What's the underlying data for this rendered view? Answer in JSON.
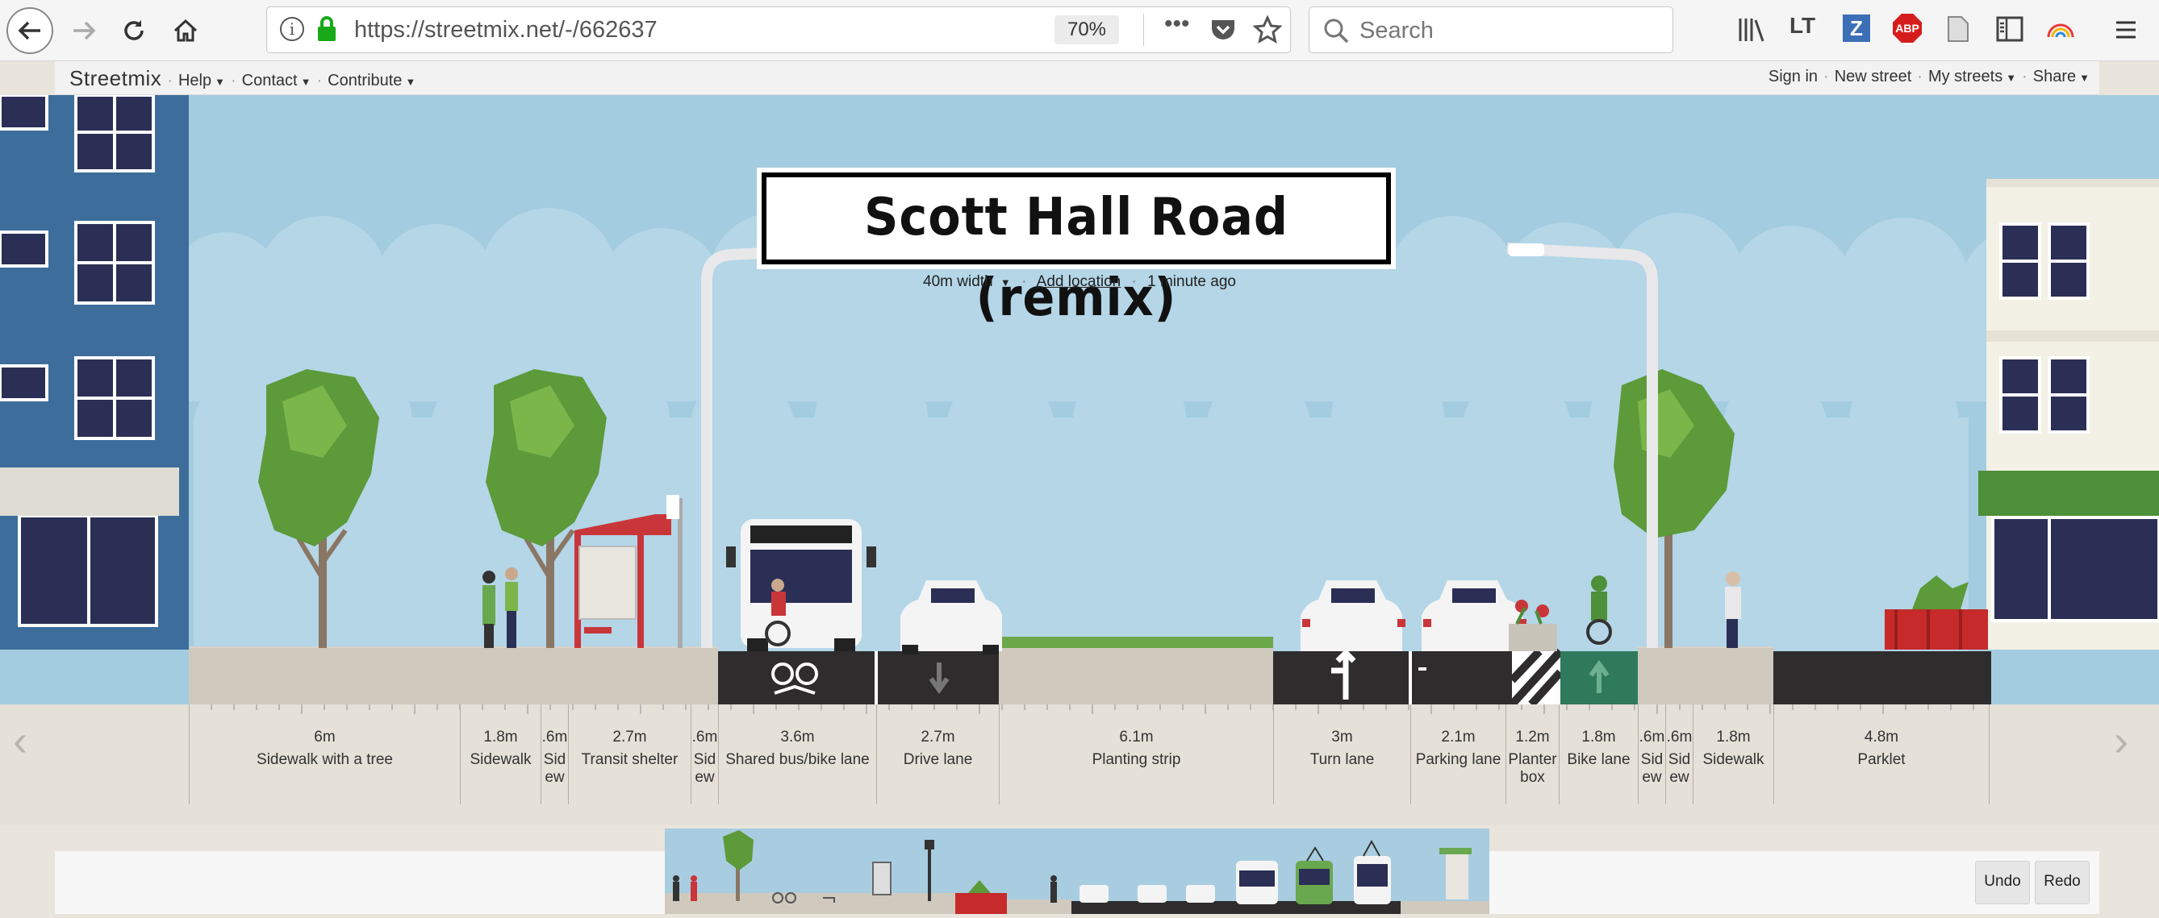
{
  "browser": {
    "url": "https://streetmix.net/-/662637",
    "zoom": "70%",
    "search_placeholder": "Search",
    "toolbar_icons": [
      "library-icon",
      "languagetool-icon",
      "zotero-icon",
      "adblock-icon",
      "reader-icon",
      "sidebar-icon",
      "rainbow-icon",
      "menu-icon"
    ],
    "tb_lt": "LT",
    "tb_z": "Z",
    "tb_abp": "ABP"
  },
  "menu": {
    "logo": "Streetmix",
    "left_items": [
      "Help",
      "Contact",
      "Contribute"
    ],
    "right_items": [
      "Sign in",
      "New street",
      "My streets",
      "Share"
    ]
  },
  "street": {
    "title": "Scott Hall Road (remix)",
    "width": "40m width",
    "add_location": "Add location",
    "updated": "1 minute ago",
    "segments": [
      {
        "width": "6m",
        "name": "Sidewalk with a tree"
      },
      {
        "width": "1.8m",
        "name": "Sidewalk"
      },
      {
        "width": ".6m",
        "name": "Sidew"
      },
      {
        "width": "2.7m",
        "name": "Transit shelter"
      },
      {
        "width": ".6m",
        "name": "Sidew"
      },
      {
        "width": "3.6m",
        "name": "Shared bus/bike lane"
      },
      {
        "width": "2.7m",
        "name": "Drive lane"
      },
      {
        "width": "6.1m",
        "name": "Planting strip"
      },
      {
        "width": "3m",
        "name": "Turn lane"
      },
      {
        "width": "2.1m",
        "name": "Parking lane"
      },
      {
        "width": "1.2m",
        "name": "Planter box"
      },
      {
        "width": "1.8m",
        "name": "Bike lane"
      },
      {
        "width": ".6m",
        "name": "Sidew"
      },
      {
        "width": ".6m",
        "name": "Sidew"
      },
      {
        "width": "1.8m",
        "name": "Sidewalk"
      },
      {
        "width": "4.8m",
        "name": "Parklet"
      }
    ]
  },
  "controls": {
    "undo": "Undo",
    "redo": "Redo"
  },
  "colors": {
    "sky": "#a4cce0",
    "building_left": "#3d6d9b",
    "building_right": "#f3f1e6",
    "tree": "#5c9a3a",
    "road": "#2f2c2e",
    "bike_lane": "#2f7a5b",
    "parklet": "#c62a2a",
    "ground": "#3a2f2b"
  }
}
